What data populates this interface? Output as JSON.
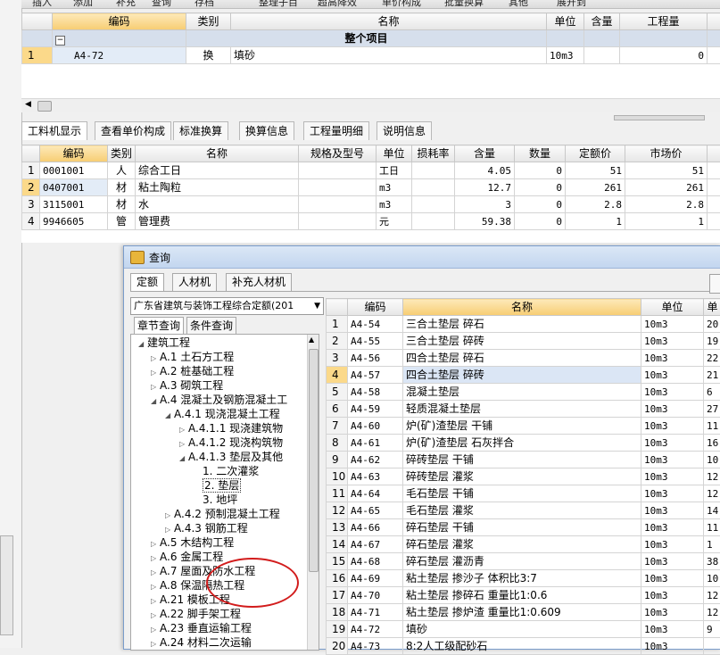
{
  "toolbar": {
    "items": [
      "插入",
      "添加",
      "补充",
      "查询",
      "存档",
      "整理子目",
      "超高降效",
      "单价构成",
      "批量换算",
      "其他",
      "展开到"
    ]
  },
  "top_table": {
    "headers": [
      "编码",
      "类别",
      "名称",
      "单位",
      "含量",
      "工程量"
    ],
    "group_label": "整个项目",
    "rows": [
      {
        "num": "1",
        "code": "A4-72",
        "type": "换",
        "name": "填砂",
        "unit": "10m3",
        "qty": "",
        "amount": "0"
      }
    ]
  },
  "tabs": [
    "工料机显示",
    "查看单价构成",
    "标准换算",
    "换算信息",
    "工程量明细",
    "说明信息"
  ],
  "mid_table": {
    "headers": [
      "编码",
      "类别",
      "名称",
      "规格及型号",
      "单位",
      "损耗率",
      "含量",
      "数量",
      "定额价",
      "市场价"
    ],
    "rows": [
      {
        "num": "1",
        "code": "0001001",
        "type": "人",
        "name": "综合工日",
        "spec": "",
        "unit": "工日",
        "loss": "",
        "content": "4.05",
        "qty": "0",
        "price": "51",
        "market": "51"
      },
      {
        "num": "2",
        "code": "0407001",
        "type": "材",
        "name": "粘土陶粒",
        "spec": "",
        "unit": "m3",
        "loss": "",
        "content": "12.7",
        "qty": "0",
        "price": "261",
        "market": "261"
      },
      {
        "num": "3",
        "code": "3115001",
        "type": "材",
        "name": "水",
        "spec": "",
        "unit": "m3",
        "loss": "",
        "content": "3",
        "qty": "0",
        "price": "2.8",
        "market": "2.8"
      },
      {
        "num": "4",
        "code": "9946605",
        "type": "管",
        "name": "管理费",
        "spec": "",
        "unit": "元",
        "loss": "",
        "content": "59.38",
        "qty": "0",
        "price": "1",
        "market": "1"
      }
    ]
  },
  "dialog": {
    "title": "查询",
    "tabs": [
      "定额",
      "人材机",
      "补充人材机"
    ],
    "selector": "广东省建筑与装饰工程综合定额(201",
    "subtabs": [
      "章节查询",
      "条件查询"
    ],
    "tree": [
      {
        "label": "建筑工程",
        "depth": 0,
        "exp": "open"
      },
      {
        "label": "A.1 土石方工程",
        "depth": 1,
        "exp": "closed"
      },
      {
        "label": "A.2 桩基础工程",
        "depth": 1,
        "exp": "closed"
      },
      {
        "label": "A.3 砌筑工程",
        "depth": 1,
        "exp": "closed"
      },
      {
        "label": "A.4 混凝土及钢筋混凝土工",
        "depth": 1,
        "exp": "open"
      },
      {
        "label": "A.4.1 现浇混凝土工程",
        "depth": 2,
        "exp": "open"
      },
      {
        "label": "A.4.1.1 现浇建筑物",
        "depth": 3,
        "exp": "closed"
      },
      {
        "label": "A.4.1.2 现浇构筑物",
        "depth": 3,
        "exp": "closed"
      },
      {
        "label": "A.4.1.3 垫层及其他",
        "depth": 3,
        "exp": "open"
      },
      {
        "label": "1. 二次灌浆",
        "depth": 4,
        "exp": "none"
      },
      {
        "label": "2. 垫层",
        "depth": 4,
        "exp": "none"
      },
      {
        "label": "3. 地坪",
        "depth": 4,
        "exp": "none"
      },
      {
        "label": "A.4.2 预制混凝土工程",
        "depth": 2,
        "exp": "closed"
      },
      {
        "label": "A.4.3 钢筋工程",
        "depth": 2,
        "exp": "closed"
      },
      {
        "label": "A.5 木结构工程",
        "depth": 1,
        "exp": "closed"
      },
      {
        "label": "A.6 金属工程",
        "depth": 1,
        "exp": "closed"
      },
      {
        "label": "A.7 屋面及防水工程",
        "depth": 1,
        "exp": "closed"
      },
      {
        "label": "A.8 保温隔热工程",
        "depth": 1,
        "exp": "closed"
      },
      {
        "label": "A.21 模板工程",
        "depth": 1,
        "exp": "closed"
      },
      {
        "label": "A.22 脚手架工程",
        "depth": 1,
        "exp": "closed"
      },
      {
        "label": "A.23 垂直运输工程",
        "depth": 1,
        "exp": "closed"
      },
      {
        "label": "A.24 材料二次运输",
        "depth": 1,
        "exp": "closed"
      }
    ],
    "grid_headers": [
      "编码",
      "名称",
      "单位",
      "单"
    ],
    "grid_rows": [
      {
        "num": "1",
        "code": "A4-54",
        "name": "三合土垫层 碎石",
        "unit": "10m3",
        "price": "20"
      },
      {
        "num": "2",
        "code": "A4-55",
        "name": "三合土垫层 碎砖",
        "unit": "10m3",
        "price": "19"
      },
      {
        "num": "3",
        "code": "A4-56",
        "name": "四合土垫层 碎石",
        "unit": "10m3",
        "price": "22"
      },
      {
        "num": "4",
        "code": "A4-57",
        "name": "四合土垫层 碎砖",
        "unit": "10m3",
        "price": "21"
      },
      {
        "num": "5",
        "code": "A4-58",
        "name": "混凝土垫层",
        "unit": "10m3",
        "price": "6"
      },
      {
        "num": "6",
        "code": "A4-59",
        "name": "轻质混凝土垫层",
        "unit": "10m3",
        "price": "27"
      },
      {
        "num": "7",
        "code": "A4-60",
        "name": "炉(矿)渣垫层 干铺",
        "unit": "10m3",
        "price": "11"
      },
      {
        "num": "8",
        "code": "A4-61",
        "name": "炉(矿)渣垫层 石灰拌合",
        "unit": "10m3",
        "price": "16"
      },
      {
        "num": "9",
        "code": "A4-62",
        "name": "碎砖垫层 干铺",
        "unit": "10m3",
        "price": "10"
      },
      {
        "num": "10",
        "code": "A4-63",
        "name": "碎砖垫层 灌浆",
        "unit": "10m3",
        "price": "12"
      },
      {
        "num": "11",
        "code": "A4-64",
        "name": "毛石垫层 干铺",
        "unit": "10m3",
        "price": "12"
      },
      {
        "num": "12",
        "code": "A4-65",
        "name": "毛石垫层 灌浆",
        "unit": "10m3",
        "price": "14"
      },
      {
        "num": "13",
        "code": "A4-66",
        "name": "碎石垫层 干铺",
        "unit": "10m3",
        "price": "11"
      },
      {
        "num": "14",
        "code": "A4-67",
        "name": "碎石垫层 灌浆",
        "unit": "10m3",
        "price": "1"
      },
      {
        "num": "15",
        "code": "A4-68",
        "name": "碎石垫层 灌沥青",
        "unit": "10m3",
        "price": "38"
      },
      {
        "num": "16",
        "code": "A4-69",
        "name": "粘土垫层 掺沙子 体积比3:7",
        "unit": "10m3",
        "price": "10"
      },
      {
        "num": "17",
        "code": "A4-70",
        "name": "粘土垫层 掺碎石 重量比1:0.6",
        "unit": "10m3",
        "price": "12"
      },
      {
        "num": "18",
        "code": "A4-71",
        "name": "粘土垫层 掺炉渣 重量比1:0.609",
        "unit": "10m3",
        "price": "12"
      },
      {
        "num": "19",
        "code": "A4-72",
        "name": "填砂",
        "unit": "10m3",
        "price": "9"
      },
      {
        "num": "20",
        "code": "A4-73",
        "name": "8:2人工级配砂石",
        "unit": "10m3",
        "price": ""
      }
    ]
  }
}
